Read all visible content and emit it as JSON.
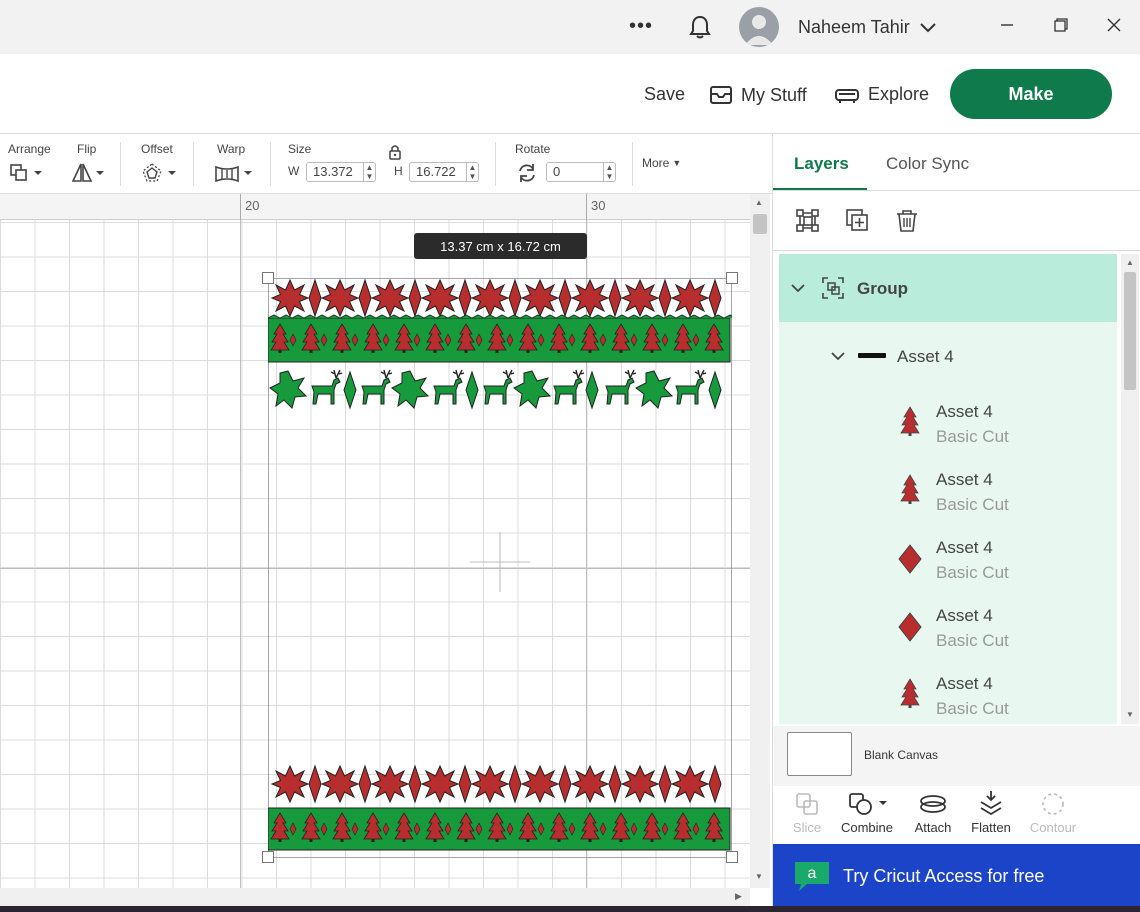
{
  "titlebar": {
    "user_name": "Naheem Tahir"
  },
  "header": {
    "save_label": "Save",
    "mystuff_label": "My Stuff",
    "explore_label": "Explore",
    "make_label": "Make"
  },
  "toolbar": {
    "arrange": "Arrange",
    "flip": "Flip",
    "offset": "Offset",
    "warp": "Warp",
    "size": "Size",
    "w_label": "W",
    "w_value": "13.372",
    "h_label": "H",
    "h_value": "16.722",
    "rotate": "Rotate",
    "rotate_value": "0",
    "more": "More"
  },
  "ruler": {
    "tick_20": "20",
    "tick_30": "30"
  },
  "canvas": {
    "size_tooltip": "13.37  cm x 16.72  cm"
  },
  "panel": {
    "tab_layers": "Layers",
    "tab_colorsync": "Color Sync",
    "group_label": "Group",
    "asset_label": "Asset 4",
    "layers": [
      {
        "name": "Asset 4",
        "op": "Basic Cut",
        "icon": "tree-icon"
      },
      {
        "name": "Asset 4",
        "op": "Basic Cut",
        "icon": "tree-icon"
      },
      {
        "name": "Asset 4",
        "op": "Basic Cut",
        "icon": "diamond-icon"
      },
      {
        "name": "Asset 4",
        "op": "Basic Cut",
        "icon": "diamond-icon"
      },
      {
        "name": "Asset 4",
        "op": "Basic Cut",
        "icon": "tree-icon"
      }
    ],
    "blank_canvas": "Blank Canvas",
    "actions": {
      "slice": "Slice",
      "combine": "Combine",
      "attach": "Attach",
      "flatten": "Flatten",
      "contour": "Contour"
    },
    "promo": "Try Cricut Access for free"
  },
  "colors": {
    "brand_green": "#0f7a4c",
    "pattern_red": "#b82e2e",
    "pattern_green": "#169a3c",
    "promo_blue": "#1b44c8",
    "layer_group_bg": "#b9ecdb"
  }
}
